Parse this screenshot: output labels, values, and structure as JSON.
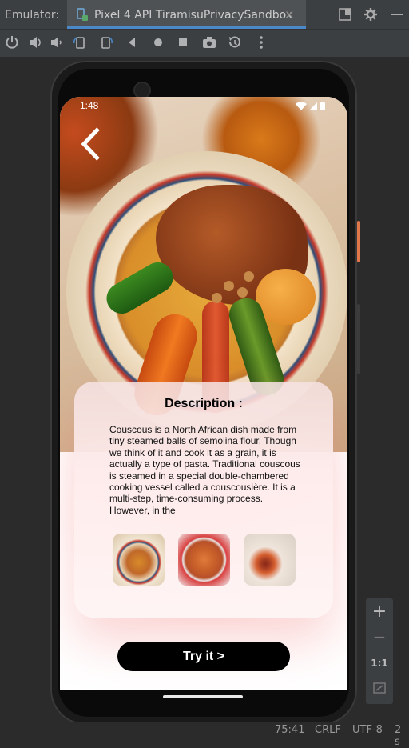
{
  "ide": {
    "emulator_label": "Emulator:",
    "device_tab": "Pixel 4 API TiramisuPrivacySandbox",
    "tab_close": "×",
    "toolbar_icons": [
      "power-icon",
      "volume-up-icon",
      "volume-down-icon",
      "rotate-left-icon",
      "rotate-right-icon",
      "back-icon",
      "home-icon",
      "overview-icon",
      "camera-icon",
      "snapshot-icon",
      "more-icon"
    ],
    "zoom": {
      "plus": "+",
      "minus": "−",
      "one_to_one": "1:1"
    },
    "status": {
      "position": "75:41",
      "line_ending": "CRLF",
      "encoding": "UTF-8",
      "indent": "2 s"
    }
  },
  "phone": {
    "time": "1:48",
    "card": {
      "title": "Description :",
      "text": "Couscous is a North African dish made from tiny steamed balls of semolina flour. Though we think of it and cook it as a grain, it is actually a type of pasta. Traditional couscous is steamed in a special double-chambered cooking vessel called a couscousière. It is a multi-step, time-consuming process. However, in the"
    },
    "try_button": "Try it >"
  },
  "colors": {
    "ide_bg": "#2b2b2b",
    "ide_panel": "#3c3f41",
    "tab_underline": "#4a88c7",
    "button_bg": "#000000",
    "card_glow": "#f89696"
  }
}
